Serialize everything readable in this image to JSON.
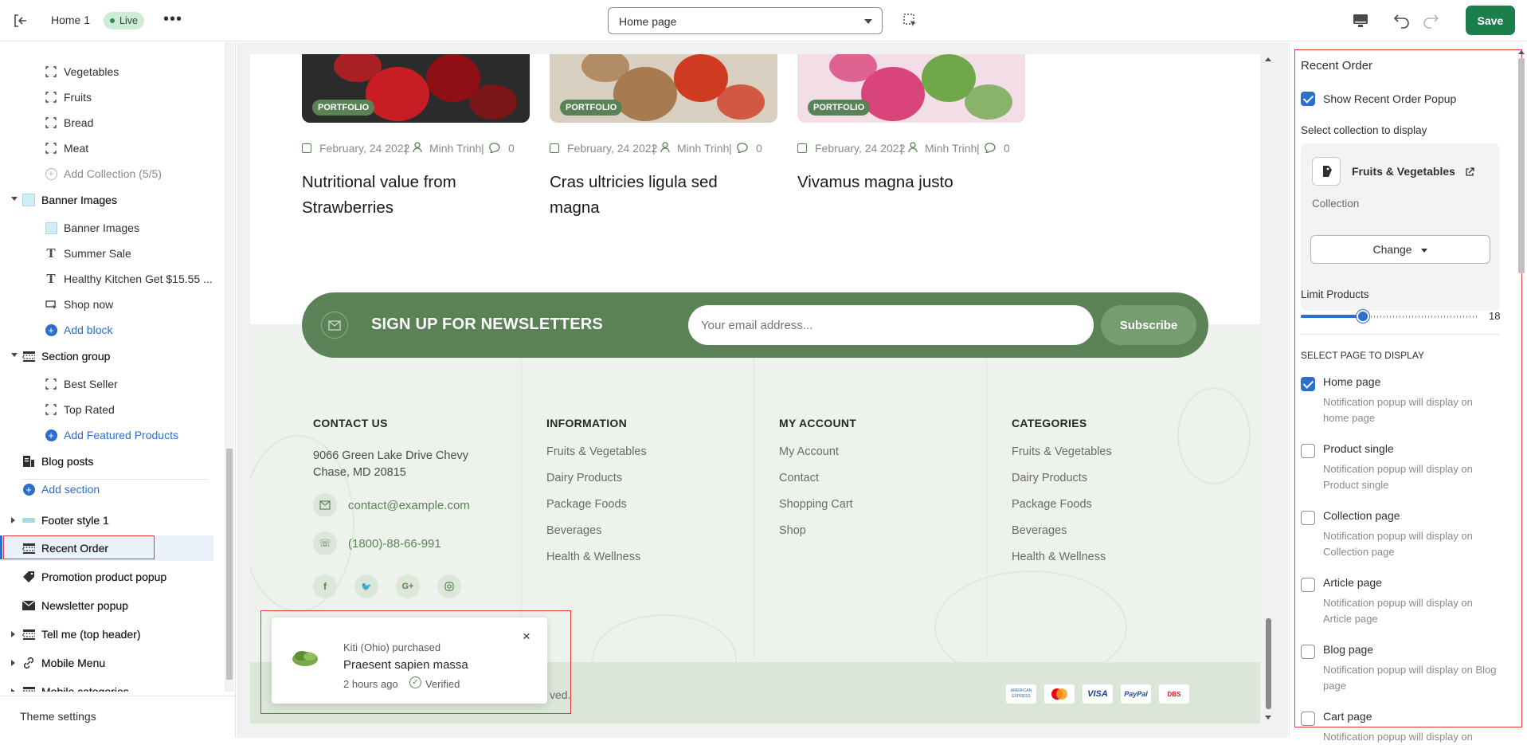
{
  "topbar": {
    "back_icon": "exit-icon",
    "theme_name": "Home 1",
    "live_badge": "Live",
    "more_icon": "ellipsis-icon",
    "page_select": "Home page",
    "inspector_icon": "select-element-icon",
    "device_icon": "desktop-icon",
    "undo_icon": "undo-icon",
    "redo_icon": "redo-icon",
    "save_label": "Save"
  },
  "sidebar": {
    "items": [
      {
        "label": "Vegetables",
        "kind": "block"
      },
      {
        "label": "Fruits",
        "kind": "block"
      },
      {
        "label": "Bread",
        "kind": "block"
      },
      {
        "label": "Meat",
        "kind": "block"
      },
      {
        "label": "Add Collection (5/5)",
        "kind": "add-disabled"
      },
      {
        "label": "Banner Images",
        "kind": "section"
      },
      {
        "label": "Banner Images",
        "kind": "image"
      },
      {
        "label": "Summer Sale",
        "kind": "text"
      },
      {
        "label": "Healthy Kitchen Get $15.55 ...",
        "kind": "text"
      },
      {
        "label": "Shop now",
        "kind": "button"
      },
      {
        "label": "Add block",
        "kind": "add"
      },
      {
        "label": "Section group",
        "kind": "section"
      },
      {
        "label": "Best Seller",
        "kind": "block"
      },
      {
        "label": "Top Rated",
        "kind": "block"
      },
      {
        "label": "Add Featured Products",
        "kind": "add"
      },
      {
        "label": "Blog posts",
        "kind": "section-plain"
      },
      {
        "label": "Add section",
        "kind": "add-section"
      },
      {
        "label": "Footer style 1",
        "kind": "section"
      },
      {
        "label": "Recent Order",
        "kind": "selected"
      },
      {
        "label": "Promotion product popup",
        "kind": "section-plain"
      },
      {
        "label": "Newsletter popup",
        "kind": "section-plain"
      },
      {
        "label": "Tell me (top header)",
        "kind": "section"
      },
      {
        "label": "Mobile Menu",
        "kind": "section"
      },
      {
        "label": "Mobile categories",
        "kind": "section"
      }
    ],
    "theme_settings": "Theme settings"
  },
  "preview": {
    "posts": [
      {
        "tag": "PORTFOLIO",
        "date": "February, 24 2022",
        "author": "Minh Trinh",
        "comments": "0",
        "title": "Nutritional value from Strawberries"
      },
      {
        "tag": "PORTFOLIO",
        "date": "February, 24 2022",
        "author": "Minh Trinh",
        "comments": "0",
        "title": "Cras ultricies ligula sed magna"
      },
      {
        "tag": "PORTFOLIO",
        "date": "February, 24 2022",
        "author": "Minh Trinh",
        "comments": "0",
        "title": "Vivamus magna justo"
      }
    ],
    "newsletter": {
      "title": "SIGN UP FOR NEWSLETTERS",
      "placeholder": "Your email address...",
      "button": "Subscribe"
    },
    "footer": {
      "contact": {
        "heading": "CONTACT US",
        "address": "9066 Green Lake Drive Chevy Chase, MD 20815",
        "email": "contact@example.com",
        "phone": "(1800)-88-66-991"
      },
      "information": {
        "heading": "INFORMATION",
        "links": [
          "Fruits & Vegetables",
          "Dairy Products",
          "Package Foods",
          "Beverages",
          "Health & Wellness"
        ]
      },
      "account": {
        "heading": "MY ACCOUNT",
        "links": [
          "My Account",
          "Contact",
          "Shopping Cart",
          "Shop"
        ]
      },
      "categories": {
        "heading": "CATEGORIES",
        "links": [
          "Fruits & Vegetables",
          "Dairy Products",
          "Package Foods",
          "Beverages",
          "Health & Wellness"
        ]
      },
      "copyright_tail": "ved.",
      "payments": [
        "AMERICAN EXPRESS",
        "MC",
        "VISA",
        "PayPal",
        "DBS"
      ]
    },
    "popup": {
      "who": "Kiti (Ohio) purchased",
      "product": "Praesent sapien massa",
      "time": "2 hours ago",
      "verified": "Verified",
      "close": "×"
    }
  },
  "settings": {
    "title": "Recent Order",
    "show_popup": {
      "label": "Show Recent Order Popup",
      "checked": true
    },
    "collection_label": "Select collection to display",
    "collection_name": "Fruits & Vegetables",
    "collection_type": "Collection",
    "change_button": "Change",
    "limit_label": "Limit Products",
    "limit_value": "18",
    "limit_fraction": 0.35,
    "pages_heading": "SELECT PAGE TO DISPLAY",
    "pages": [
      {
        "title": "Home page",
        "desc": "Notification popup will display on home page",
        "checked": true
      },
      {
        "title": "Product single",
        "desc": "Notification popup will display on Product single",
        "checked": false
      },
      {
        "title": "Collection page",
        "desc": "Notification popup will display on Collection page",
        "checked": false
      },
      {
        "title": "Article page",
        "desc": "Notification popup will display on Article page",
        "checked": false
      },
      {
        "title": "Blog page",
        "desc": "Notification popup will display on Blog page",
        "checked": false
      },
      {
        "title": "Cart page",
        "desc": "Notification popup will display on",
        "checked": false
      }
    ]
  },
  "colors": {
    "accent": "#2c6ecb",
    "green": "#5b8256",
    "save": "#1a7f4b",
    "highlight": "#e53935"
  }
}
